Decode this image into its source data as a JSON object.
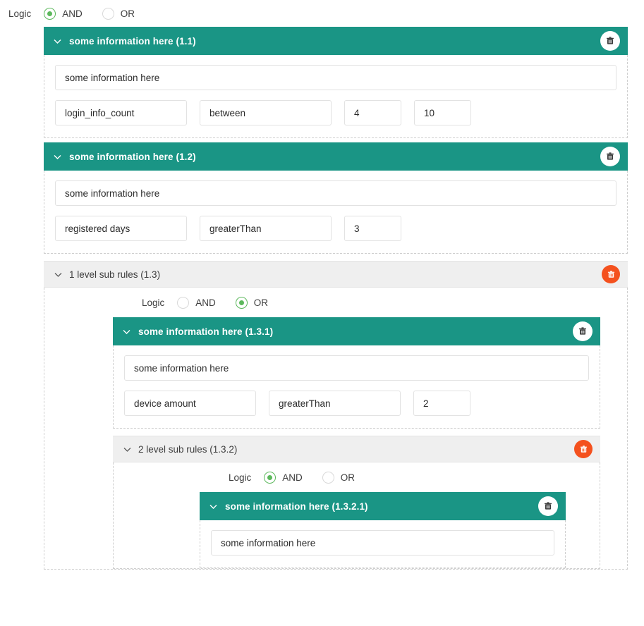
{
  "root": {
    "logic": {
      "label": "Logic",
      "options": [
        {
          "label": "AND",
          "selected": true
        },
        {
          "label": "OR",
          "selected": false
        }
      ]
    }
  },
  "rules": {
    "r11": {
      "title": "some information here (1.1)",
      "description": "some information here",
      "field_name": "login_info_count",
      "operator": "between",
      "value_1": "4",
      "value_2": "10",
      "delete_icon": "trash-icon",
      "collapse_icon": "chevron-down-icon"
    },
    "r12": {
      "title": "some information here (1.2)",
      "description": "some information here",
      "field_name": "registered days",
      "operator": "greaterThan",
      "value_1": "3",
      "delete_icon": "trash-icon",
      "collapse_icon": "chevron-down-icon"
    },
    "g13": {
      "title": "1 level sub rules (1.3)",
      "delete_icon": "trash-icon",
      "collapse_icon": "chevron-down-icon",
      "logic": {
        "label": "Logic",
        "options": [
          {
            "label": "AND",
            "selected": false
          },
          {
            "label": "OR",
            "selected": true
          }
        ]
      }
    },
    "r131": {
      "title": "some information here (1.3.1)",
      "description": "some information here",
      "field_name": "device amount",
      "operator": "greaterThan",
      "value_1": "2",
      "delete_icon": "trash-icon",
      "collapse_icon": "chevron-down-icon"
    },
    "g132": {
      "title": "2 level sub rules (1.3.2)",
      "delete_icon": "trash-icon",
      "collapse_icon": "chevron-down-icon",
      "logic": {
        "label": "Logic",
        "options": [
          {
            "label": "AND",
            "selected": true
          },
          {
            "label": "OR",
            "selected": false
          }
        ]
      }
    },
    "r1321": {
      "title": "some information here (1.3.2.1)",
      "description": "some information here",
      "delete_icon": "trash-icon",
      "collapse_icon": "chevron-down-icon"
    }
  },
  "colors": {
    "rule_header": "#1a9585",
    "group_header": "#efefef",
    "delete_orange": "#f4511e",
    "radio_green": "#5cb85c"
  }
}
